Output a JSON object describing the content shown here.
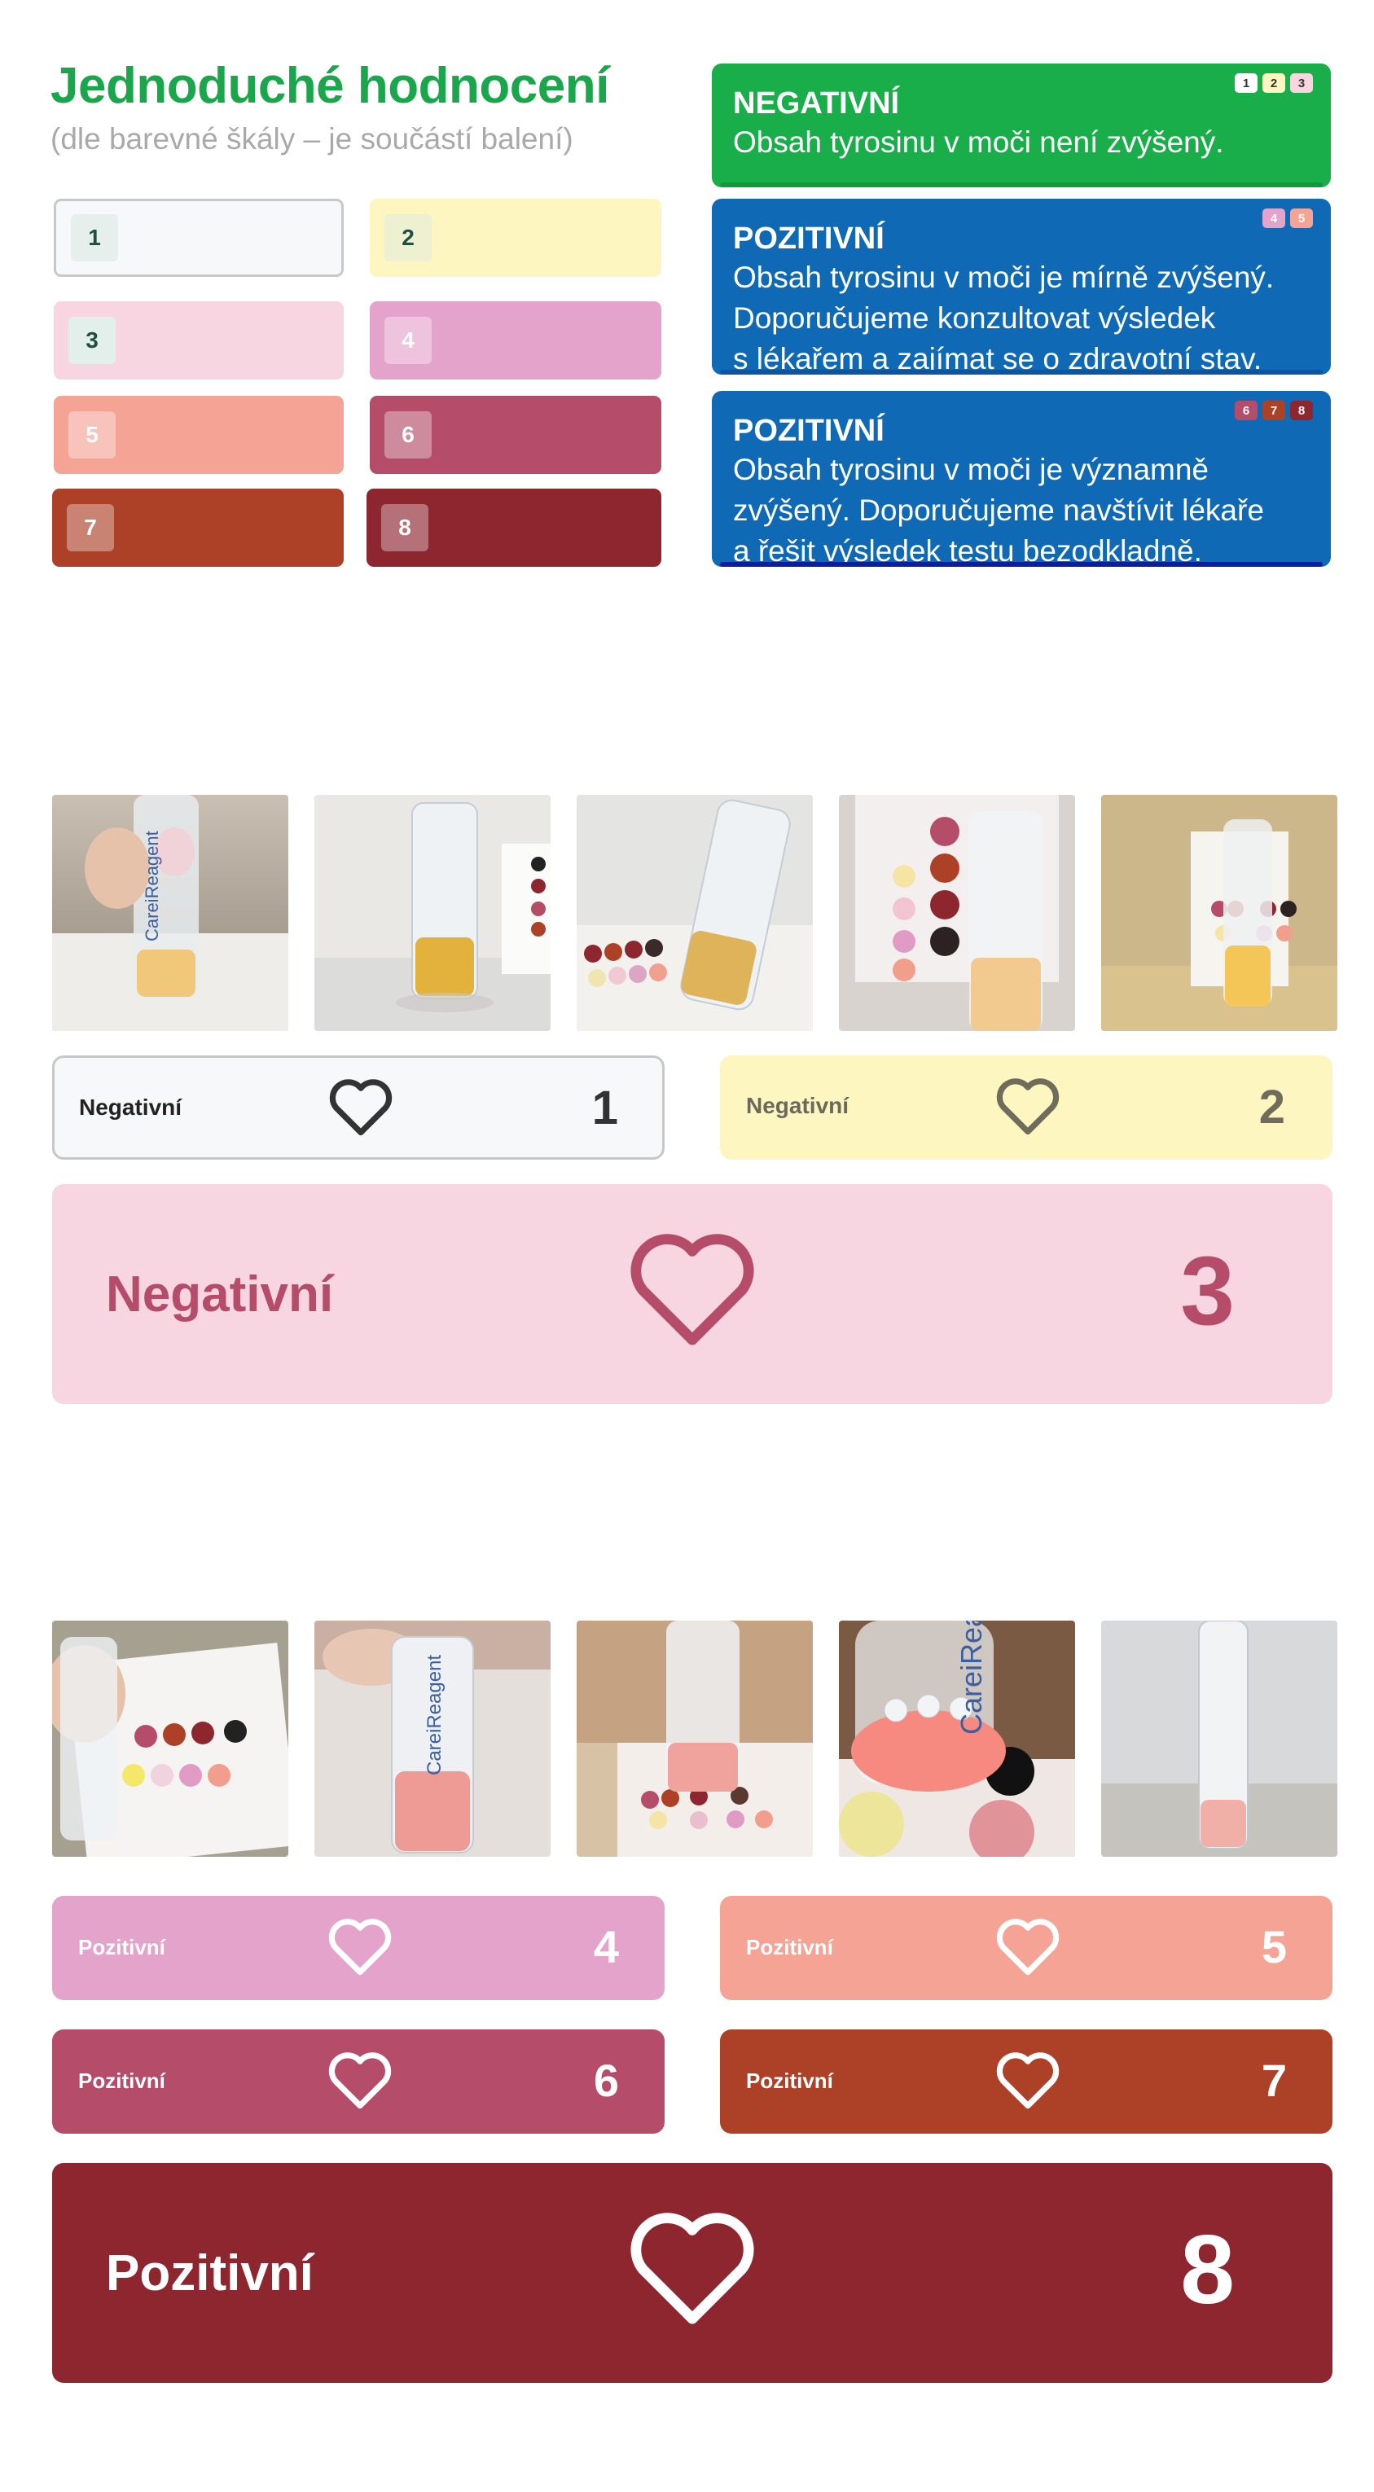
{
  "header": {
    "title": "Jednoduché hodnocení",
    "subtitle": "(dle barevné škály – je součástí balení)"
  },
  "scale": [
    {
      "n": "1",
      "color": "#f6f8f9"
    },
    {
      "n": "2",
      "color": "#fdf6c0"
    },
    {
      "n": "3",
      "color": "#f7d6e2"
    },
    {
      "n": "4",
      "color": "#e3a3cb"
    },
    {
      "n": "5",
      "color": "#f4a395"
    },
    {
      "n": "6",
      "color": "#b54d6a"
    },
    {
      "n": "7",
      "color": "#ad4127"
    },
    {
      "n": "8",
      "color": "#8e2630"
    }
  ],
  "results": [
    {
      "title": "NEGATIVNÍ",
      "lines": [
        "Obsah tyrosinu v moči není zvýšený."
      ],
      "chips": [
        "1",
        "2",
        "3"
      ],
      "bg": "#1aae4b",
      "bar": "#0e9a3a"
    },
    {
      "title": "POZITIVNÍ",
      "lines": [
        "Obsah tyrosinu v moči je mírně zvýšený.",
        "Doporučujeme konzultovat výsledek",
        "s lékařem a zajímat se o zdravotní stav."
      ],
      "chips": [
        "4",
        "5"
      ],
      "bg": "#0f69b4",
      "bar": "#0c55a0"
    },
    {
      "title": "POZITIVNÍ",
      "lines": [
        "Obsah tyrosinu v moči je významně",
        "zvýšený. Doporučujeme navštívit lékaře",
        "a řešit výsledek testu bezodkladně."
      ],
      "chips": [
        "6",
        "7",
        "8"
      ],
      "bg": "#0f69b4",
      "bar": "#0a1fa0"
    }
  ],
  "cards": [
    {
      "label": "Negativní",
      "num": "1"
    },
    {
      "label": "Negativní",
      "num": "2"
    },
    {
      "label": "Negativní",
      "num": "3"
    },
    {
      "label": "Pozitivní",
      "num": "4"
    },
    {
      "label": "Pozitivní",
      "num": "5"
    },
    {
      "label": "Pozitivní",
      "num": "6"
    },
    {
      "label": "Pozitivní",
      "num": "7"
    },
    {
      "label": "Pozitivní",
      "num": "8"
    }
  ],
  "photo_labels": [
    "CareiReagent",
    "CareiReagent",
    "CareiReagent"
  ]
}
